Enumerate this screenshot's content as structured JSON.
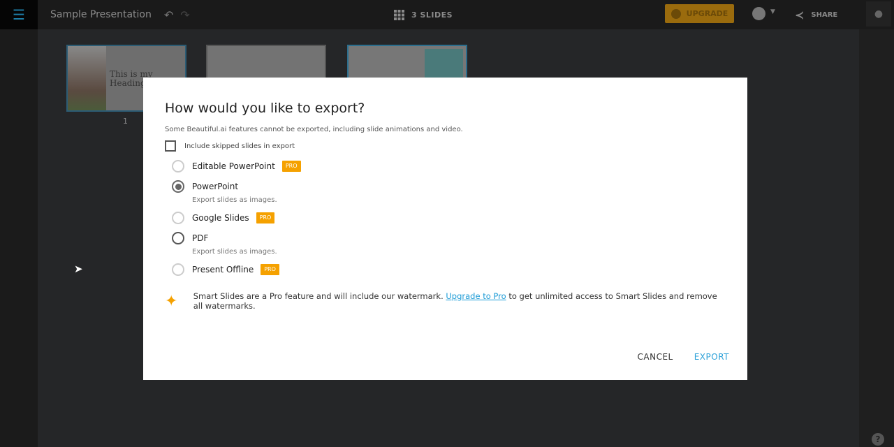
{
  "topbar": {
    "title": "Sample Presentation",
    "slides_count": "3 SLIDES",
    "upgrade": "UPGRADE",
    "share": "SHARE"
  },
  "thumbnails": {
    "slide1_text": "This is my Heading",
    "slide1_number": "1"
  },
  "dialog": {
    "title": "How would you like to export?",
    "subtitle": "Some Beautiful.ai features cannot be exported, including slide animations and video.",
    "include_skipped": {
      "label": "Include skipped slides in export",
      "checked": false
    },
    "options": [
      {
        "label": "Editable PowerPoint",
        "pro": "PRO",
        "selected": false
      },
      {
        "label": "PowerPoint",
        "hint": "Export slides as images.",
        "selected": true
      },
      {
        "label": "Google Slides",
        "pro": "PRO",
        "selected": false
      },
      {
        "label": "PDF",
        "hint": "Export slides as images.",
        "selected": false
      },
      {
        "label": "Present Offline",
        "pro": "PRO",
        "selected": false
      }
    ],
    "smart_before": "Smart Slides are a Pro feature and will include our watermark. ",
    "smart_link": "Upgrade to Pro",
    "smart_after": " to get unlimited access to Smart Slides and remove all watermarks.",
    "cancel": "CANCEL",
    "export": "EXPORT"
  },
  "colors": {
    "accent": "#2aa0d8",
    "pro": "#f5a100"
  }
}
